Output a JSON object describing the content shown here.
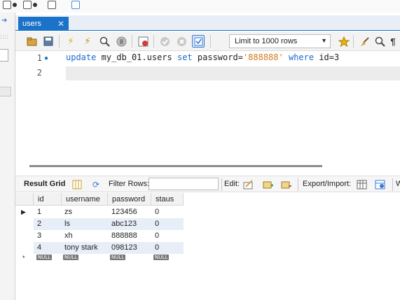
{
  "tab": {
    "title": "users",
    "close": "✕"
  },
  "editor": {
    "lines": [
      {
        "number": "1",
        "has_bullet": true
      },
      {
        "number": "2",
        "has_bullet": false
      }
    ],
    "code": {
      "kw_update": "update",
      "table": "my_db_01.users",
      "kw_set": "set",
      "column": "password",
      "op": "=",
      "value": "'888888'",
      "kw_where": "where",
      "condition": "id=3"
    }
  },
  "toolbar": {
    "limit_label": "Limit to 1000 rows"
  },
  "result_toolbar": {
    "result_grid": "Result Grid",
    "filter_rows": "Filter Rows:",
    "edit": "Edit:",
    "export_import": "Export/Import:",
    "wrap": "W"
  },
  "grid": {
    "columns": [
      "id",
      "username",
      "password",
      "staus"
    ],
    "rows": [
      [
        "1",
        "zs",
        "123456",
        "0"
      ],
      [
        "2",
        "ls",
        "abc123",
        "0"
      ],
      [
        "3",
        "xh",
        "888888",
        "0"
      ],
      [
        "4",
        "tony stark",
        "098123",
        "0"
      ]
    ],
    "null_label": "NULL"
  },
  "colors": {
    "accent": "#1a73c8",
    "keyword": "#1a6ec8",
    "string": "#d07a22",
    "row_alt": "#e8eef8"
  }
}
